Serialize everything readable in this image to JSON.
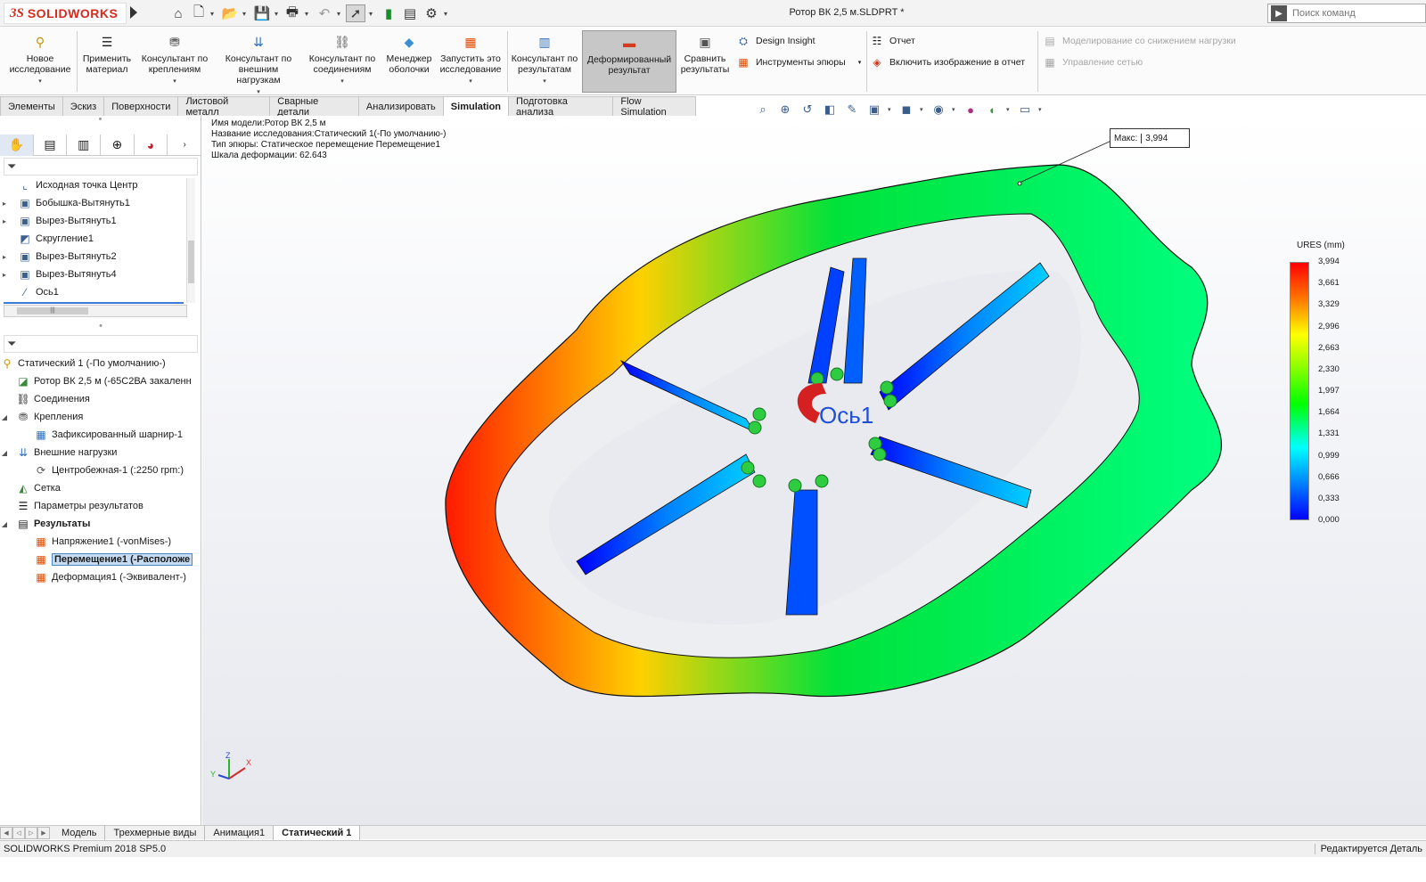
{
  "app": {
    "logo_ds": "3S",
    "logo_name": "SOLIDWORKS",
    "document_title": "Ротор ВК 2,5 м.SLDPRT *"
  },
  "search": {
    "placeholder": "Поиск команд"
  },
  "ribbon": {
    "new_study": [
      "Новое",
      "исследование"
    ],
    "apply_material": [
      "Применить",
      "материал"
    ],
    "fixtures_advisor": [
      "Консультант по",
      "креплениям"
    ],
    "loads_advisor": [
      "Консультант по",
      "внешним нагрузкам"
    ],
    "connections_advisor": [
      "Консультант по",
      "соединениям"
    ],
    "shell_manager": [
      "Менеджер",
      "оболочки"
    ],
    "run_study": [
      "Запустить это",
      "исследование"
    ],
    "results_advisor": [
      "Консультант по",
      "результатам"
    ],
    "deformed_result": [
      "Деформированный",
      "результат"
    ],
    "compare_results": [
      "Сравнить",
      "результаты"
    ],
    "design_insight": "Design Insight",
    "plot_tools": "Инструменты эпюры",
    "report": "Отчет",
    "include_image": "Включить изображение в отчет",
    "reduced_load_sim": "Моделирование со снижением нагрузки",
    "mesh_control": "Управление сетью"
  },
  "tabs": [
    {
      "label": "Элементы",
      "active": false
    },
    {
      "label": "Эскиз",
      "active": false
    },
    {
      "label": "Поверхности",
      "active": false
    },
    {
      "label": "Листовой металл",
      "active": false
    },
    {
      "label": "Сварные детали",
      "active": false
    },
    {
      "label": "Анализировать",
      "active": false
    },
    {
      "label": "Simulation",
      "active": true
    },
    {
      "label": "Подготовка анализа",
      "active": false
    },
    {
      "label": "Flow Simulation",
      "active": false
    }
  ],
  "feature_tree": [
    {
      "label": "Исходная точка Центр",
      "icon": "origin-icon",
      "expander": false
    },
    {
      "label": "Бобышка-Вытянуть1",
      "icon": "boss-extrude-icon",
      "expander": true
    },
    {
      "label": "Вырез-Вытянуть1",
      "icon": "cut-extrude-icon",
      "expander": true
    },
    {
      "label": "Скругление1",
      "icon": "fillet-icon",
      "expander": false
    },
    {
      "label": "Вырез-Вытянуть2",
      "icon": "cut-extrude-icon",
      "expander": true
    },
    {
      "label": "Вырез-Вытянуть4",
      "icon": "cut-extrude-icon",
      "expander": true
    },
    {
      "label": "Ось1",
      "icon": "axis-icon",
      "expander": false
    }
  ],
  "study_tree": {
    "study": "Статический 1 (-По умолчанию-)",
    "part": "Ротор ВК 2,5 м (-65С2ВА закаленн",
    "connections": "Соединения",
    "fixtures": "Крепления",
    "fixture_item": "Зафиксированный шарнир-1",
    "external_loads": "Внешние нагрузки",
    "load_item": "Центробежная-1 (:2250 rpm:)",
    "mesh": "Сетка",
    "result_options": "Параметры результатов",
    "results": "Результаты",
    "stress": "Напряжение1 (-vonMises-)",
    "displacement": "Перемещение1 (-Расположе",
    "strain": "Деформация1 (-Эквивалент-)"
  },
  "plot_info": {
    "model_name": "Имя модели:Ротор ВК 2,5 м",
    "study_name": "Название исследования:Статический 1(-По умолчанию-)",
    "plot_type": "Тип эпюры: Статическое перемещение Перемещение1",
    "deformation_scale": "Шкала деформации: 62.643"
  },
  "max_probe": {
    "label": "Макс:",
    "value": "3,994"
  },
  "axis_label": "Ось1",
  "legend": {
    "title": "URES (mm)",
    "ticks": [
      "3,994",
      "3,661",
      "3,329",
      "2,996",
      "2,663",
      "2,330",
      "1,997",
      "1,664",
      "1,331",
      "0,999",
      "0,666",
      "0,333",
      "0,000"
    ]
  },
  "triad": {
    "x": "X",
    "y": "Y",
    "z": "Z"
  },
  "bottom_tabs": [
    {
      "label": "Модель",
      "active": false
    },
    {
      "label": "Трехмерные виды",
      "active": false
    },
    {
      "label": "Анимация1",
      "active": false
    },
    {
      "label": "Статический 1",
      "active": true
    }
  ],
  "status": {
    "left": "SOLIDWORKS Premium 2018 SP5.0",
    "right": "Редактируется Деталь"
  },
  "colors": {
    "accent": "#d52b1e",
    "selection": "#c6dcf3",
    "axis_blue": "#1f4fd6"
  }
}
